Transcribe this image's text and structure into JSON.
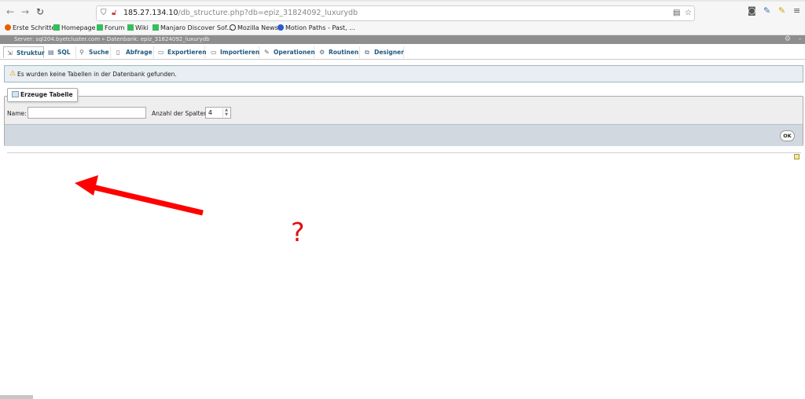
{
  "browser": {
    "url_host": "185.27.134.10",
    "url_path": "/db_structure.php?db=epiz_31824092_luxurydb",
    "bookmarks": [
      {
        "label": "Erste Schritte",
        "icon": "firefox-icon"
      },
      {
        "label": "Homepage",
        "icon": "manjaro-icon"
      },
      {
        "label": "Forum",
        "icon": "manjaro-icon"
      },
      {
        "label": "Wiki",
        "icon": "manjaro-icon"
      },
      {
        "label": "Manjaro Discover Sof...",
        "icon": "manjaro-icon"
      },
      {
        "label": "Mozilla News",
        "icon": "globe-icon"
      },
      {
        "label": "Motion Paths - Past, ...",
        "icon": "blue-circle-icon"
      }
    ]
  },
  "pma": {
    "breadcrumb_server": "Server: sql204.byetcluster.com",
    "breadcrumb_sep": "»",
    "breadcrumb_db": "Datenbank: epiz_31824092_luxurydb",
    "tabs": [
      {
        "label": "Struktur",
        "icon": "structure-icon",
        "active": true
      },
      {
        "label": "SQL",
        "icon": "sql-icon"
      },
      {
        "label": "Suche",
        "icon": "search-icon"
      },
      {
        "label": "Abfrage",
        "icon": "query-icon"
      },
      {
        "label": "Exportieren",
        "icon": "export-icon"
      },
      {
        "label": "Importieren",
        "icon": "import-icon"
      },
      {
        "label": "Operationen",
        "icon": "operations-icon"
      },
      {
        "label": "Routinen",
        "icon": "routines-icon"
      },
      {
        "label": "Designer",
        "icon": "designer-icon"
      }
    ],
    "notice": "Es wurden keine Tabellen in der Datenbank gefunden.",
    "create_table": {
      "legend": "Erzeuge Tabelle",
      "name_label": "Name:",
      "name_value": "",
      "columns_label": "Anzahl der Spalten:",
      "columns_value": "4",
      "ok_label": "OK"
    }
  },
  "annotation": {
    "question_mark": "?",
    "arrow_color": "#ff0000"
  },
  "colors": {
    "tab_text": "#235a81",
    "notice_bg": "#e8eef1",
    "form_footer_bg": "#d2d8e0"
  }
}
